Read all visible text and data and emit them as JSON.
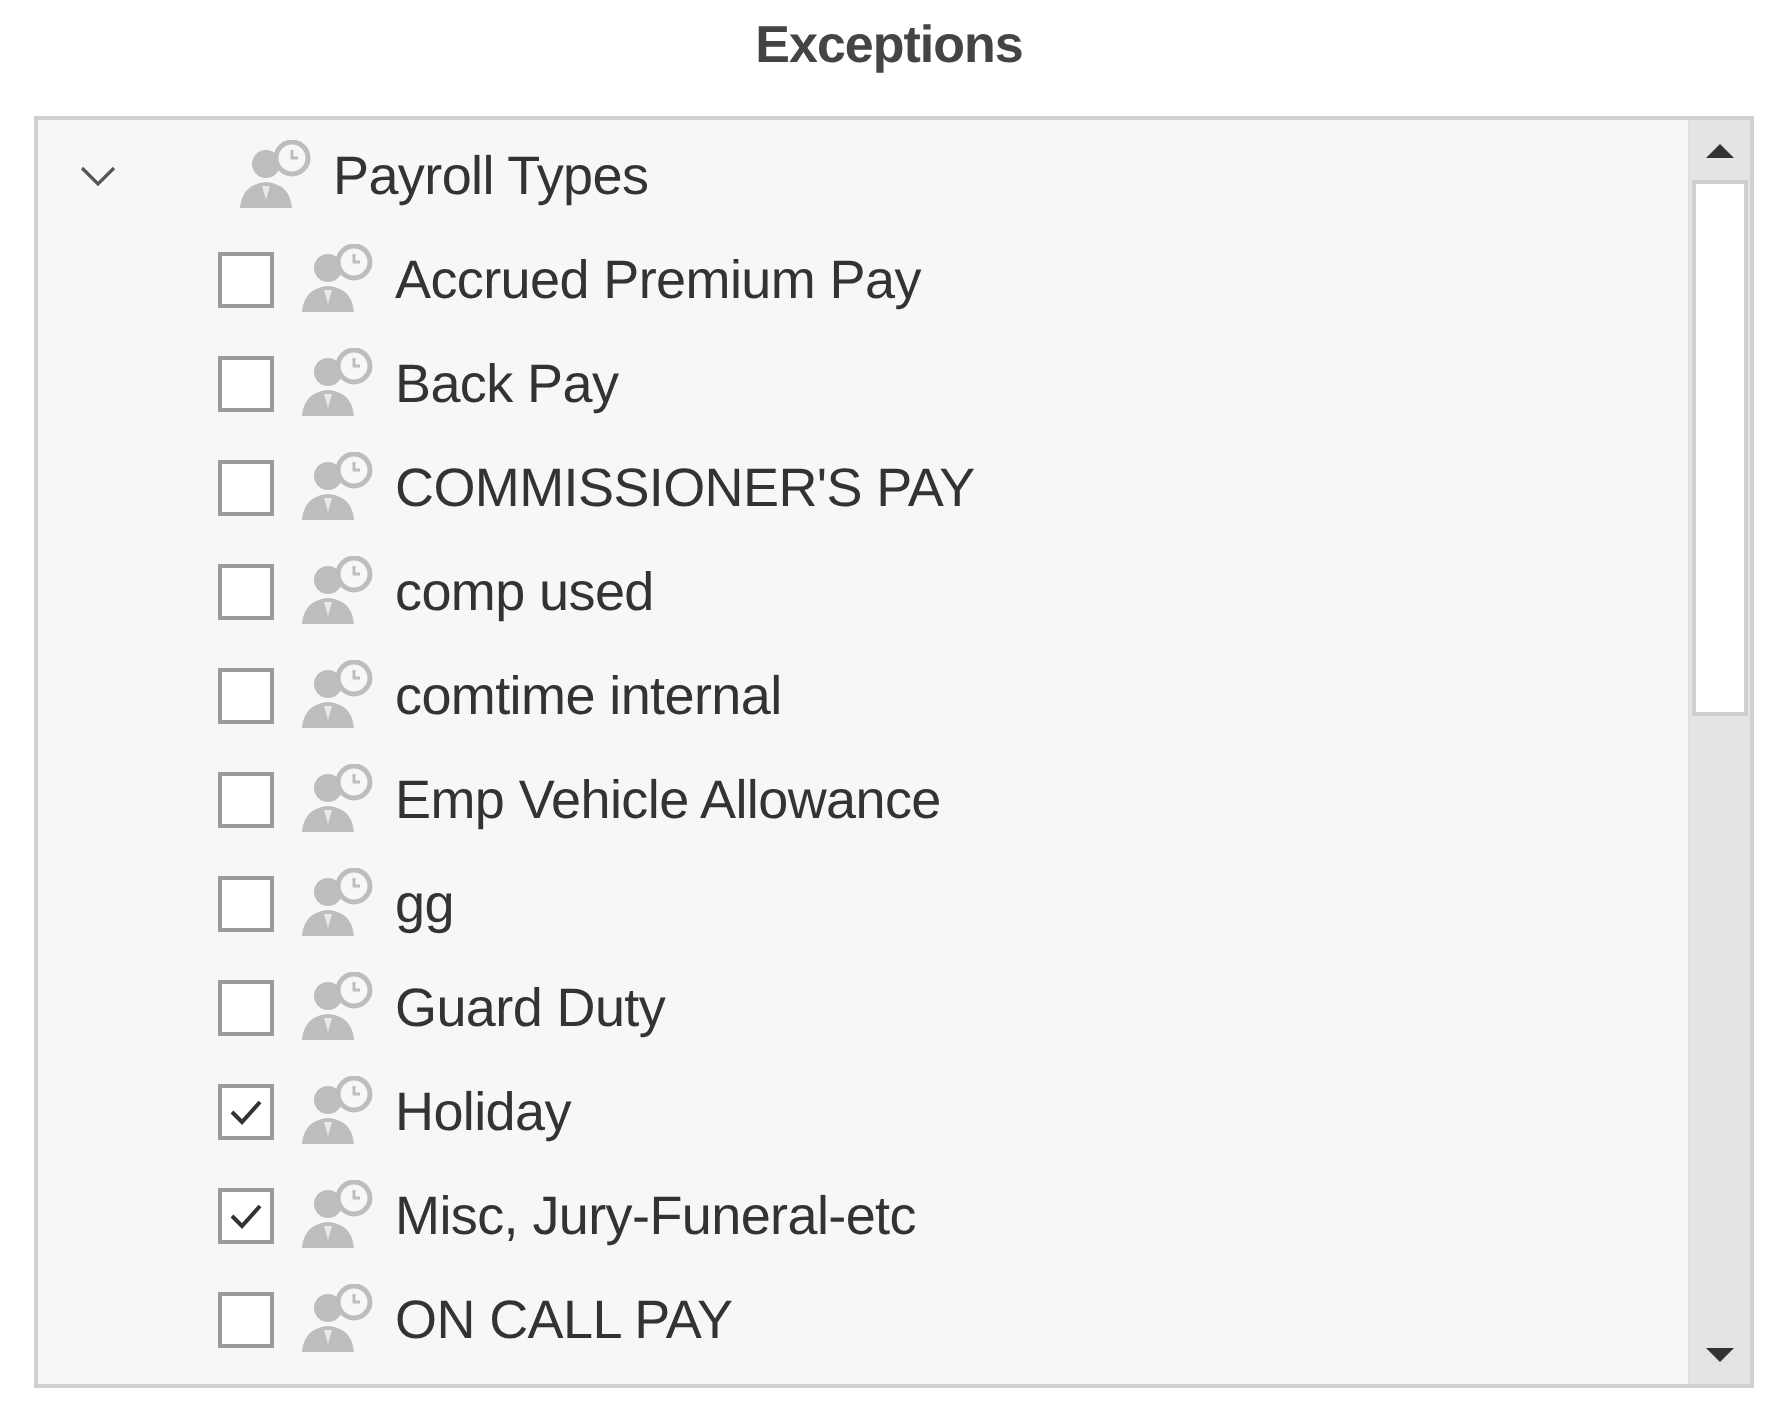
{
  "title": "Exceptions",
  "tree": [
    {
      "label": "Payroll Types",
      "expanded": true,
      "children": [
        {
          "label": "Accrued Premium Pay",
          "checked": false
        },
        {
          "label": "Back Pay",
          "checked": false
        },
        {
          "label": "COMMISSIONER'S PAY",
          "checked": false
        },
        {
          "label": "comp used",
          "checked": false
        },
        {
          "label": "comtime internal",
          "checked": false
        },
        {
          "label": "Emp Vehicle Allowance",
          "checked": false
        },
        {
          "label": "gg",
          "checked": false
        },
        {
          "label": "Guard Duty",
          "checked": false
        },
        {
          "label": "Holiday",
          "checked": true
        },
        {
          "label": "Misc, Jury-Funeral-etc",
          "checked": true
        },
        {
          "label": "ON CALL PAY",
          "checked": false
        }
      ]
    }
  ]
}
